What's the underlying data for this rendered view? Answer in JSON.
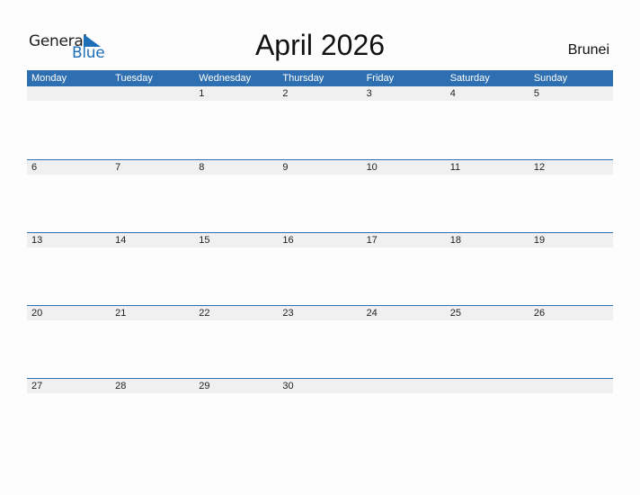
{
  "logo": {
    "text_top": "General",
    "text_bottom": "Blue",
    "icon": "triangle-flag-icon"
  },
  "header": {
    "title": "April 2026",
    "country": "Brunei"
  },
  "calendar": {
    "weekdays": [
      "Monday",
      "Tuesday",
      "Wednesday",
      "Thursday",
      "Friday",
      "Saturday",
      "Sunday"
    ],
    "weeks": [
      [
        "",
        "",
        "1",
        "2",
        "3",
        "4",
        "5"
      ],
      [
        "6",
        "7",
        "8",
        "9",
        "10",
        "11",
        "12"
      ],
      [
        "13",
        "14",
        "15",
        "16",
        "17",
        "18",
        "19"
      ],
      [
        "20",
        "21",
        "22",
        "23",
        "24",
        "25",
        "26"
      ],
      [
        "27",
        "28",
        "29",
        "30",
        "",
        "",
        ""
      ]
    ]
  },
  "colors": {
    "accent": "#2e6fb1",
    "logo_blue": "#1e6fb8",
    "day_bar": "#f0f0f0"
  }
}
